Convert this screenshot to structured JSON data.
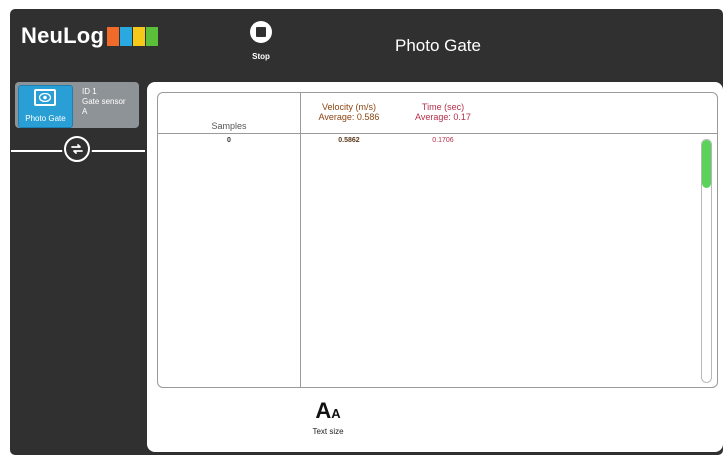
{
  "app": {
    "logo_text": "NeuLog",
    "logo_colors": [
      "#f06a2a",
      "#2aa9e0",
      "#f5c81a",
      "#5bbf3a"
    ]
  },
  "toolbar": {
    "stop_label": "Stop",
    "stop_icon": "stop-circle-icon"
  },
  "header": {
    "title": "Photo Gate"
  },
  "sensor": {
    "name": "Photo Gate",
    "id_line": "ID 1",
    "type_line": "Gate sensor",
    "mode_line": "A",
    "icon": "eye-icon"
  },
  "table": {
    "samples_header": "Samples",
    "columns": [
      {
        "label": "Velocity (m/s)",
        "average": "Average: 0.586",
        "color": "#8b4513"
      },
      {
        "label": "Time (sec)",
        "average": "Average: 0.17",
        "color": "#b4304a"
      }
    ],
    "rows": [
      {
        "sample": "0",
        "velocity": "0.5862",
        "time": "0.1706"
      }
    ]
  },
  "footer": {
    "text_size_label": "Text size",
    "text_size_icon": "text-size-icon"
  },
  "colors": {
    "frame": "#303030",
    "accent": "#2a9fd6",
    "scroll_thumb": "#5bd35b"
  }
}
